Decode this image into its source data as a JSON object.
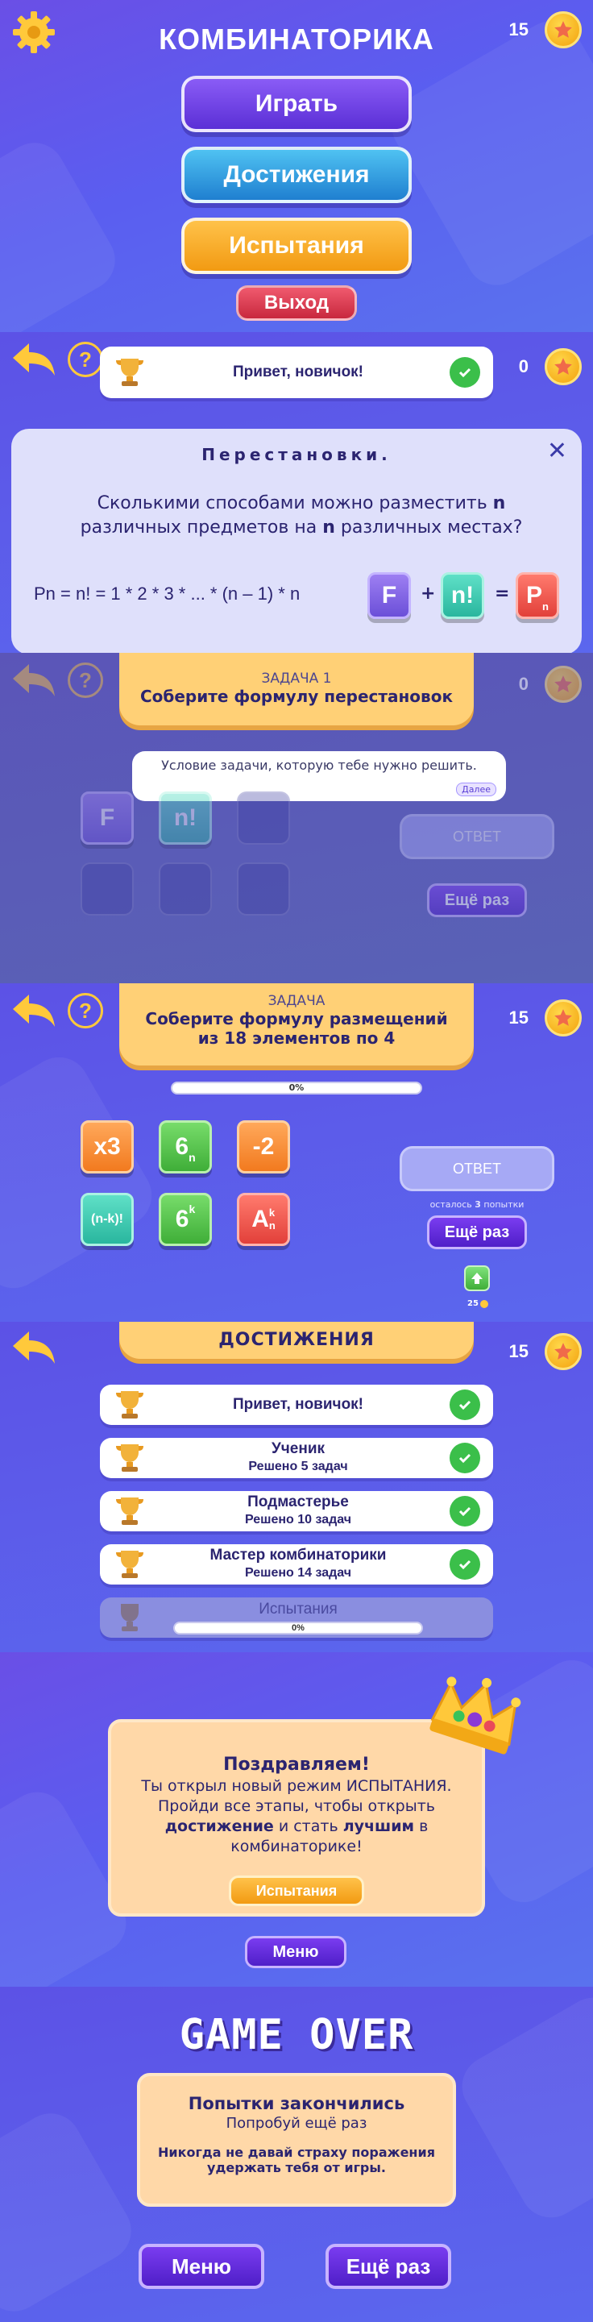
{
  "colors": {
    "accent": "#ffc93b",
    "primary": "#5b2fd6",
    "success": "#3bbf4a",
    "card": "#ffd8a8"
  },
  "main_menu": {
    "title": "КОМБИНАТОРИКА",
    "coins": "15",
    "play": "Играть",
    "achievements": "Достижения",
    "challenges": "Испытания",
    "exit": "Выход"
  },
  "intro": {
    "coins": "0",
    "toast": "Привет, новичок!",
    "card_title": "Перестановки.",
    "question_a": "Сколькими способами можно разместить ",
    "question_n1": "n",
    "question_b": " различных предметов на ",
    "question_n2": "n",
    "question_c": " различных местах?",
    "formula": "Pn = n! = 1 * 2 * 3 * ... * (n – 1) * n",
    "tiles": {
      "f": "F",
      "plus": "+",
      "nfact": "n!",
      "eq": "=",
      "p": "P",
      "p_sub": "n"
    }
  },
  "tutorial": {
    "coins": "0",
    "task_label": "ЗАДАЧА 1",
    "task_text": "Соберите формулу перестановок",
    "tooltip": "Условие задачи, которую тебе нужно решить.",
    "more": "Далее",
    "tiles": [
      "F",
      "n!"
    ],
    "answer": "ОТВЕТ",
    "again": "Ещё раз"
  },
  "game": {
    "coins": "15",
    "task_label": "ЗАДАЧА",
    "task_text_1": "Соберите формулу размещений",
    "task_text_2": "из 18 элементов по 4",
    "progress": "0%",
    "tiles": [
      {
        "main": "x3",
        "sup": "",
        "sub": ""
      },
      {
        "main": "6",
        "sup": "",
        "sub": "n"
      },
      {
        "main": "-2",
        "sup": "",
        "sub": ""
      },
      {
        "main": "(n-k)!",
        "sup": "",
        "sub": ""
      },
      {
        "main": "6",
        "sup": "k",
        "sub": ""
      },
      {
        "main": "A",
        "sup": "k",
        "sub": "n"
      }
    ],
    "answer": "ОТВЕТ",
    "attempts_a": "осталось ",
    "attempts_n": "3",
    "attempts_b": " попытки",
    "again": "Ещё раз",
    "hint_cost": "25"
  },
  "achievements": {
    "coins": "15",
    "title": "ДОСТИЖЕНИЯ",
    "items": [
      {
        "title": "Привет, новичок!",
        "sub": ""
      },
      {
        "title": "Ученик",
        "sub": "Решено 5 задач"
      },
      {
        "title": "Подмастерье",
        "sub": "Решено 10 задач"
      },
      {
        "title": "Мастер комбинаторики",
        "sub": "Решено 14 задач"
      }
    ],
    "locked_title": "Испытания",
    "locked_progress": "0%"
  },
  "congrats": {
    "title": "Поздравляем!",
    "line1": "Ты открыл новый режим ИСПЫТАНИЯ.",
    "line2": "Пройди все этапы, чтобы открыть",
    "line3_b1": "достижение",
    "line3_mid": " и стать ",
    "line3_b2": "лучшим",
    "line3_end": " в",
    "line4": "комбинаторике!",
    "button": "Испытания",
    "menu": "Меню"
  },
  "gameover": {
    "title": "GAME OVER",
    "line1": "Попытки закончились",
    "line2": "Попробуй ещё раз",
    "line3": "Никогда не давай страху поражения",
    "line4": "удержать тебя от игры.",
    "menu": "Меню",
    "again": "Ещё раз"
  }
}
